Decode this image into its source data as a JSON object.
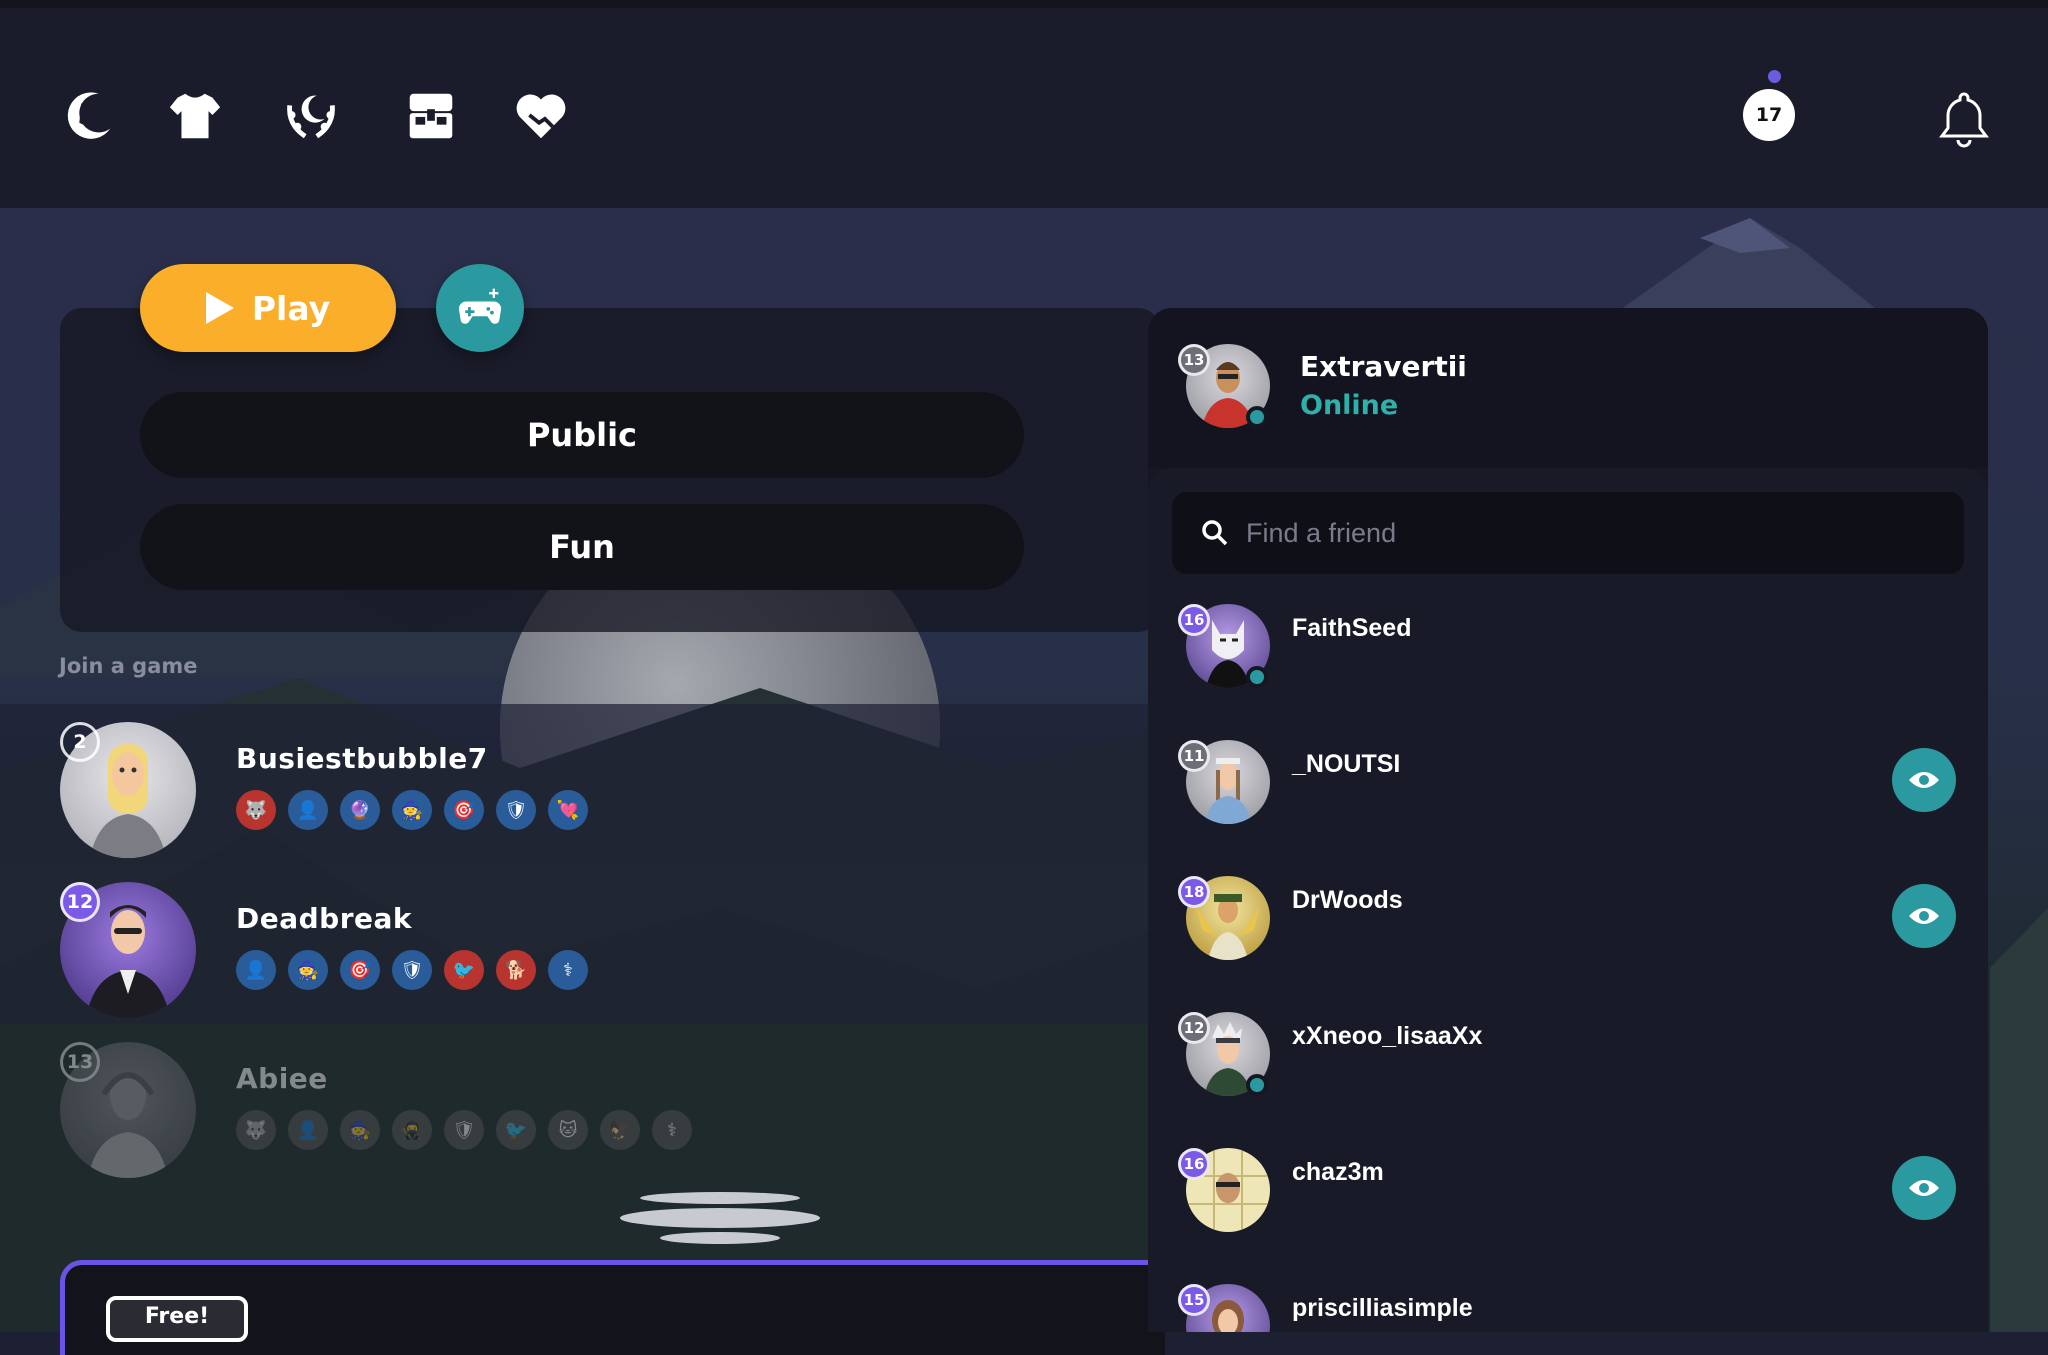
{
  "topbar": {
    "icons": [
      "wolf-moon-icon",
      "shirt-icon",
      "laurel-moon-icon",
      "treasure-chest-icon",
      "heart-handshake-icon"
    ],
    "level": "17",
    "notification_icon": "bell-icon"
  },
  "actions": {
    "play_label": "Play",
    "create_game_icon": "controller-plus-icon",
    "modes": [
      "Public",
      "Fun"
    ]
  },
  "games": {
    "section_label": "Join a game",
    "rows": [
      {
        "host": "Busiestbubble7",
        "level": "2",
        "level_color": "#6e6e78",
        "roles": [
          "#b8342e",
          "#2a5c9a",
          "#2a5c9a",
          "#2a5c9a",
          "#2a5c9a",
          "#2a5c9a",
          "#2a5c9a"
        ],
        "dimmed": false
      },
      {
        "host": "Deadbreak",
        "level": "12",
        "level_color": "#7a5ae6",
        "roles": [
          "#2a5c9a",
          "#2a5c9a",
          "#2a5c9a",
          "#2a5c9a",
          "#b8342e",
          "#b8342e",
          "#2a5c9a"
        ],
        "dimmed": false
      },
      {
        "host": "Abiee",
        "level": "13",
        "level_color": "#6e6e78",
        "roles": [
          "#555",
          "#555",
          "#555",
          "#555",
          "#555",
          "#555",
          "#555",
          "#555",
          "#555"
        ],
        "dimmed": true
      }
    ]
  },
  "promo": {
    "badge": "Free!"
  },
  "friends": {
    "me": {
      "name": "Extravertii",
      "status": "Online",
      "level": "13"
    },
    "search_placeholder": "Find a friend",
    "search_icon": "search-icon",
    "list": [
      {
        "name": "FaithSeed",
        "level": "16",
        "level_color": "#7a5ae6",
        "online": true,
        "spectate": false
      },
      {
        "name": "_NOUTSI",
        "level": "11",
        "level_color": "#6e6e78",
        "online": false,
        "spectate": true
      },
      {
        "name": "DrWoods",
        "level": "18",
        "level_color": "#7a5ae6",
        "online": false,
        "spectate": true
      },
      {
        "name": "xXneoo_lisaaXx",
        "level": "12",
        "level_color": "#6e6e78",
        "online": true,
        "spectate": false
      },
      {
        "name": "chaz3m",
        "level": "16",
        "level_color": "#7a5ae6",
        "online": false,
        "spectate": true
      },
      {
        "name": "priscilliasimple",
        "level": "15",
        "level_color": "#7a5ae6",
        "online": false,
        "spectate": false
      }
    ]
  },
  "colors": {
    "play": "#fbae2a",
    "teal": "#2a9aa0",
    "online": "#2fb0a8",
    "accent_purple": "#6a53e6"
  }
}
